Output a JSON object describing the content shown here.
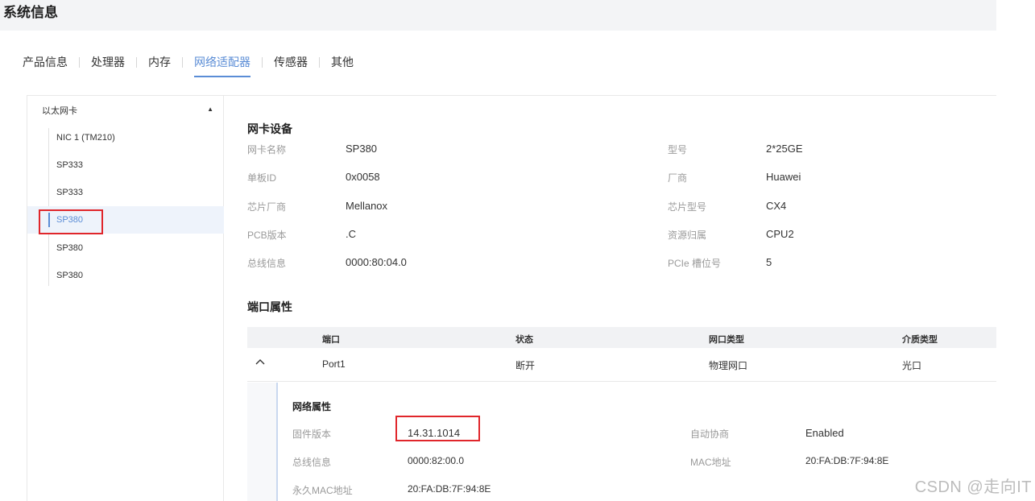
{
  "page": {
    "title": "系统信息"
  },
  "tabs": [
    {
      "label": "产品信息"
    },
    {
      "label": "处理器"
    },
    {
      "label": "内存"
    },
    {
      "label": "网络适配器"
    },
    {
      "label": "传感器"
    },
    {
      "label": "其他"
    }
  ],
  "sidebar": {
    "group_label": "以太网卡",
    "items": [
      {
        "label": "NIC 1 (TM210)"
      },
      {
        "label": "SP333"
      },
      {
        "label": "SP333"
      },
      {
        "label": "SP380"
      },
      {
        "label": "SP380"
      },
      {
        "label": "SP380"
      }
    ]
  },
  "nic": {
    "title": "网卡设备",
    "fields": [
      {
        "label": "网卡名称",
        "value": "SP380"
      },
      {
        "label": "型号",
        "value": "2*25GE"
      },
      {
        "label": "单板ID",
        "value": "0x0058"
      },
      {
        "label": "厂商",
        "value": "Huawei"
      },
      {
        "label": "芯片厂商",
        "value": "Mellanox"
      },
      {
        "label": "芯片型号",
        "value": "CX4"
      },
      {
        "label": "PCB版本",
        "value": ".C"
      },
      {
        "label": "资源归属",
        "value": "CPU2"
      },
      {
        "label": "总线信息",
        "value": "0000:80:04.0"
      },
      {
        "label": "PCIe 槽位号",
        "value": "5"
      }
    ]
  },
  "ports": {
    "title": "端口属性",
    "columns": [
      "端口",
      "状态",
      "网口类型",
      "介质类型"
    ],
    "rows": [
      {
        "port": "Port1",
        "status": "断开",
        "type": "物理网口",
        "medium": "光口"
      }
    ],
    "toggle_icon": "chevron-up-icon",
    "detail": {
      "title": "网络属性",
      "fields": [
        {
          "label": "固件版本",
          "value": "14.31.1014"
        },
        {
          "label": "自动协商",
          "value": "Enabled"
        },
        {
          "label": "总线信息",
          "value": "0000:82:00.0"
        },
        {
          "label": "MAC地址",
          "value": "20:FA:DB:7F:94:8E"
        },
        {
          "label": "永久MAC地址",
          "value": "20:FA:DB:7F:94:8E"
        }
      ]
    }
  },
  "watermark": "CSDN @走向IT",
  "colors": {
    "accent": "#5b8dd6",
    "highlight": "#e0262b"
  }
}
